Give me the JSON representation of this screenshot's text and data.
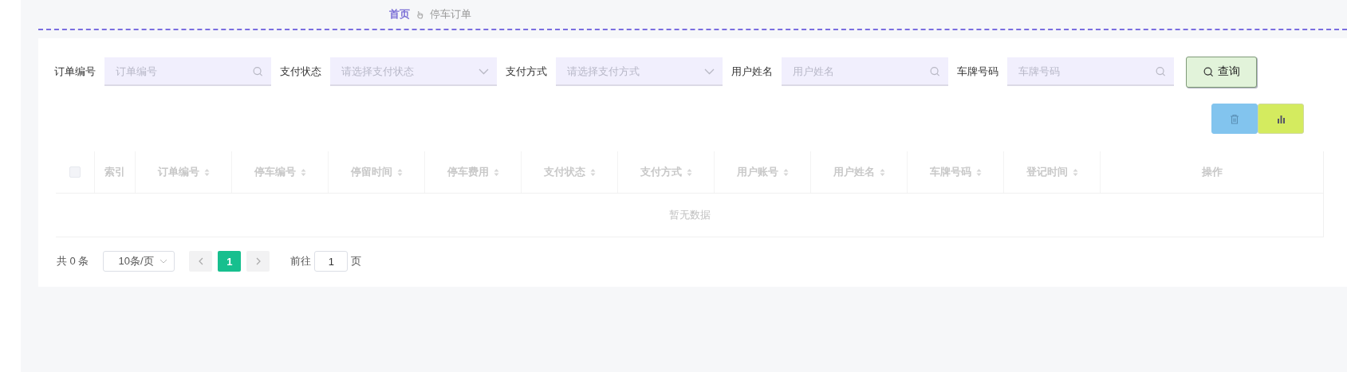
{
  "breadcrumb": [
    {
      "label": "首页",
      "current": false
    },
    {
      "label": "停车订单",
      "current": true
    }
  ],
  "filters": [
    {
      "label": "订单编号",
      "placeholder": "订单编号",
      "kind": "search"
    },
    {
      "label": "支付状态",
      "placeholder": "请选择支付状态",
      "kind": "select"
    },
    {
      "label": "支付方式",
      "placeholder": "请选择支付方式",
      "kind": "select"
    },
    {
      "label": "用户姓名",
      "placeholder": "用户姓名",
      "kind": "search"
    },
    {
      "label": "车牌号码",
      "placeholder": "车牌号码",
      "kind": "search"
    }
  ],
  "query_button": "查询",
  "toolbar": [
    {
      "kind": "delete"
    },
    {
      "kind": "chart"
    }
  ],
  "table": {
    "select_all": {
      "checked": false
    },
    "columns": [
      {
        "label": "索引",
        "sortable": false
      },
      {
        "label": "订单编号",
        "sortable": true
      },
      {
        "label": "停车编号",
        "sortable": true
      },
      {
        "label": "停留时间",
        "sortable": true
      },
      {
        "label": "停车费用",
        "sortable": true
      },
      {
        "label": "支付状态",
        "sortable": true
      },
      {
        "label": "支付方式",
        "sortable": true
      },
      {
        "label": "用户账号",
        "sortable": true
      },
      {
        "label": "用户姓名",
        "sortable": true
      },
      {
        "label": "车牌号码",
        "sortable": true
      },
      {
        "label": "登记时间",
        "sortable": true
      },
      {
        "label": "操作",
        "sortable": false
      }
    ],
    "empty_text": "暂无数据"
  },
  "pagination": {
    "total": "共 0 条",
    "page_size": "10条/页",
    "pages": [
      {
        "label": "1",
        "selected": true
      }
    ],
    "goto_label": "前往",
    "goto_value": "1",
    "goto_suffix": "页"
  }
}
